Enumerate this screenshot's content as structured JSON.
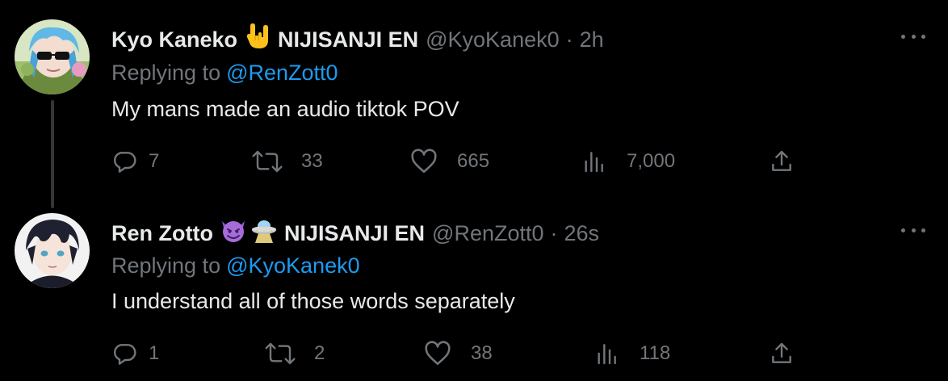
{
  "tweets": [
    {
      "author_name": "Kyo Kaneko",
      "author_emoji": "rock-on-hand-emoji",
      "agency": "NIJISANJI EN",
      "handle": "@KyoKanek0",
      "separator": "·",
      "time": "2h",
      "reply_prefix": "Replying to",
      "reply_to": "@RenZott0",
      "text": "My mans made an audio tiktok POV",
      "replies": "7",
      "retweets": "33",
      "likes": "665",
      "views": "7,000"
    },
    {
      "author_name": "Ren Zotto",
      "author_emoji": "smiling-devil-and-ufo-emoji",
      "agency": "NIJISANJI EN",
      "handle": "@RenZott0",
      "separator": "·",
      "time": "26s",
      "reply_prefix": "Replying to",
      "reply_to": "@KyoKanek0",
      "text": "I understand all of those words separately",
      "replies": "1",
      "retweets": "2",
      "likes": "38",
      "views": "118"
    }
  ],
  "colors": {
    "background": "#000000",
    "primary_text": "#e7e9ea",
    "secondary_text": "#71767b",
    "link": "#1d9bf0",
    "thread_line": "#333639"
  }
}
